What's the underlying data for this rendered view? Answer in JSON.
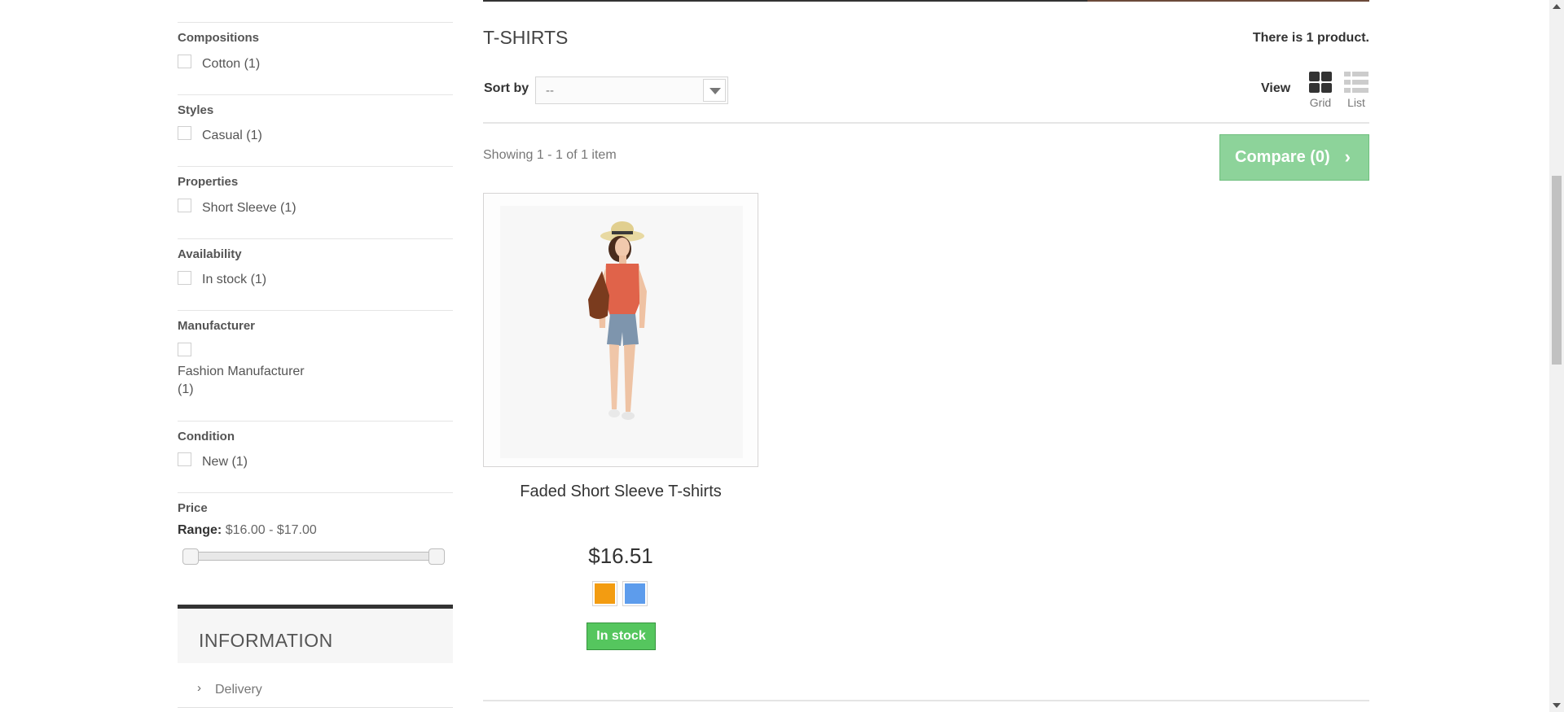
{
  "filters": [
    {
      "title": "Compositions",
      "options": [
        "Cotton (1)"
      ]
    },
    {
      "title": "Styles",
      "options": [
        "Casual (1)"
      ]
    },
    {
      "title": "Properties",
      "options": [
        "Short Sleeve (1)"
      ]
    },
    {
      "title": "Availability",
      "options": [
        "In stock (1)"
      ]
    },
    {
      "title": "Manufacturer",
      "options": [
        "Fashion Manufacturer",
        "(1)"
      ]
    },
    {
      "title": "Condition",
      "options": [
        "New (1)"
      ]
    }
  ],
  "price_filter": {
    "title": "Price",
    "range_label": "Range:",
    "range_value": "$16.00 - $17.00",
    "slider_min_fraction": 0,
    "slider_max_fraction": 1
  },
  "information": {
    "title": "INFORMATION",
    "items": [
      "Delivery"
    ]
  },
  "category": {
    "heading": "T-SHIRTS",
    "count_text": "There is 1 product."
  },
  "sort": {
    "label": "Sort by",
    "value": "--"
  },
  "view": {
    "label": "View",
    "grid_label": "Grid",
    "list_label": "List",
    "active": "grid"
  },
  "showing_text": "Showing 1 - 1 of 1 item",
  "compare": {
    "label": "Compare (0)",
    "chevron": "›"
  },
  "product": {
    "name": "Faded Short Sleeve T-shirts",
    "price": "$16.51",
    "swatches": [
      "#f39c11",
      "#5d9cec"
    ],
    "stock": "In stock"
  },
  "colors": {
    "compare_button": "#8dd39a",
    "in_stock_badge": "#55c65e"
  },
  "icons": {
    "grid": "grid-icon",
    "list": "list-icon",
    "chevron": "chevron-right-icon"
  }
}
